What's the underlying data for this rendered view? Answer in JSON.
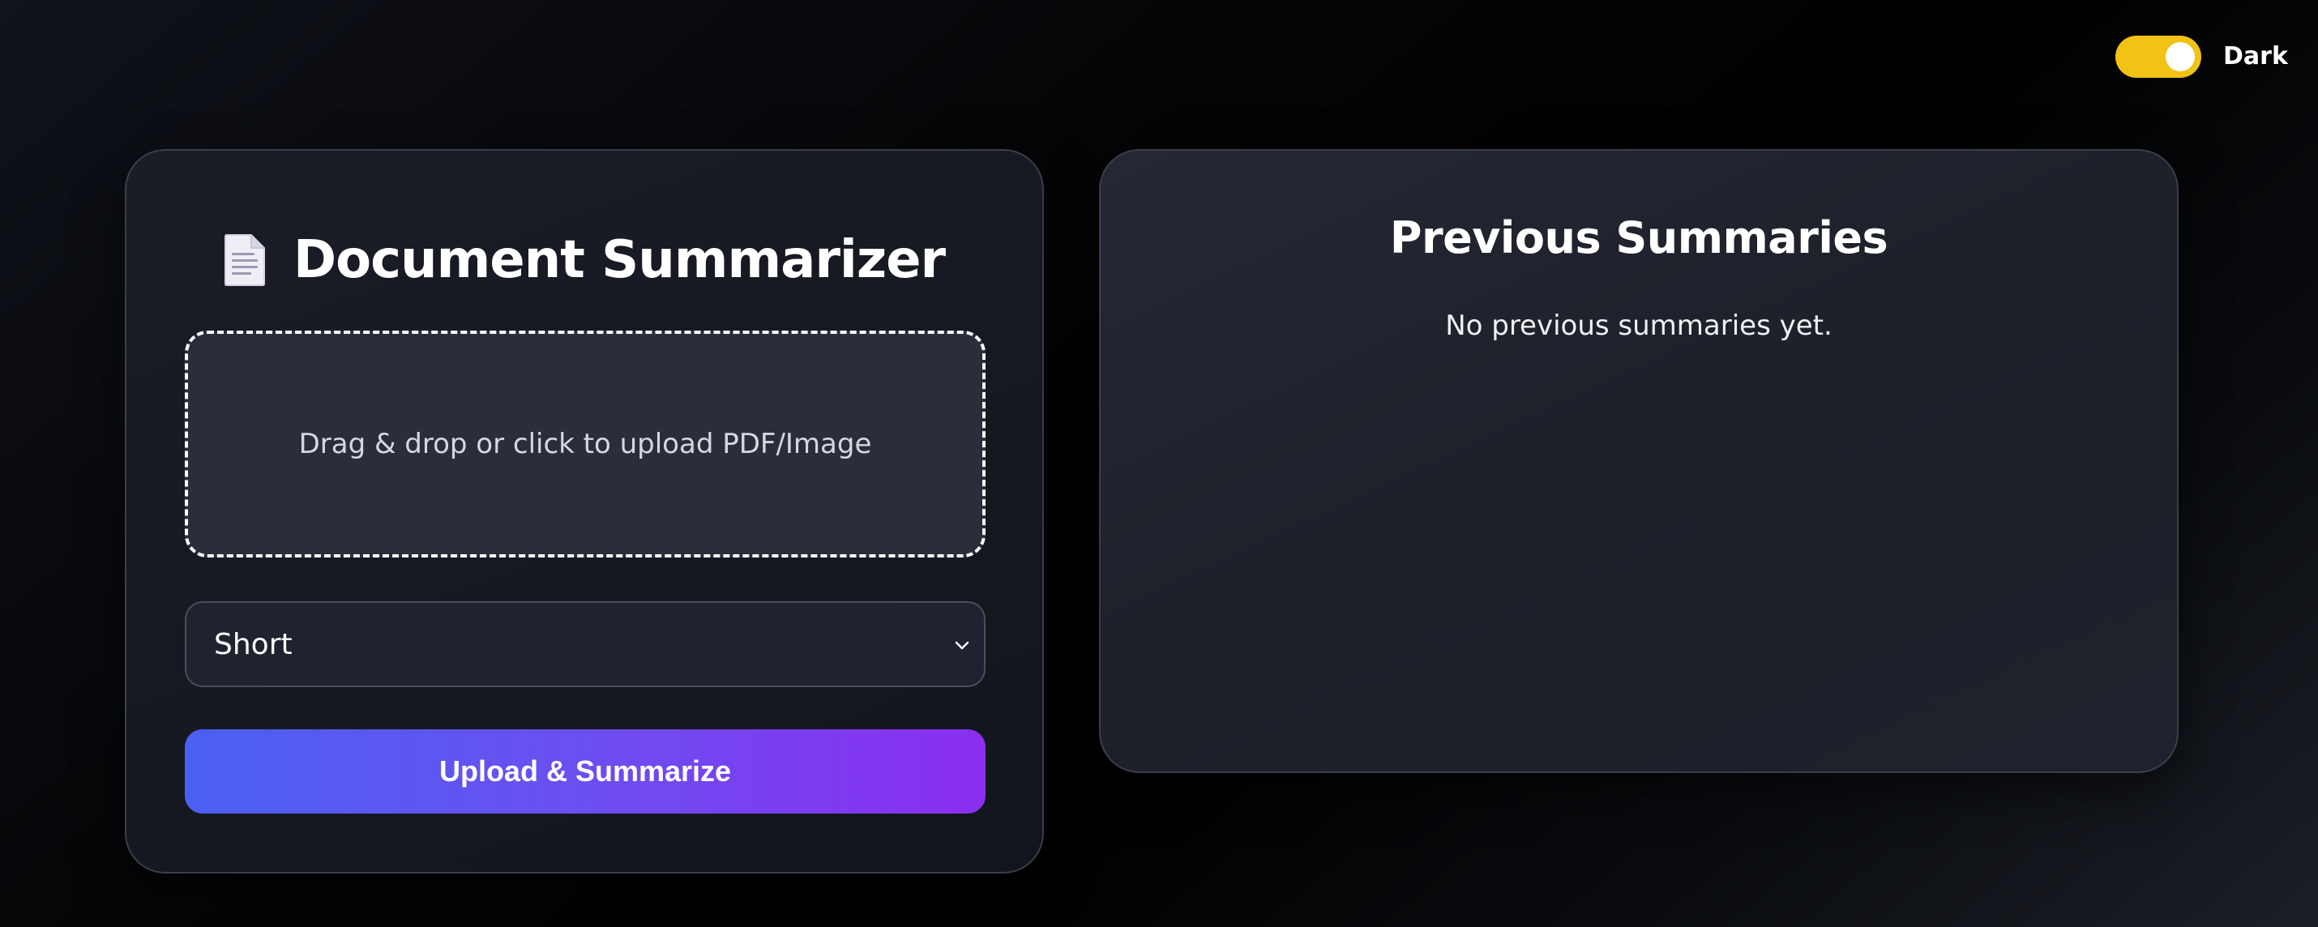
{
  "theme_toggle": {
    "label": "Dark",
    "state": "on",
    "accent_color": "#f2c214"
  },
  "summarizer_card": {
    "icon": "document-icon",
    "title": "Document Summarizer",
    "dropzone_text": "Drag & drop or click to upload PDF/Image",
    "length_select": {
      "selected": "Short"
    },
    "submit_label": "Upload & Summarize",
    "submit_gradient": [
      "#4a60f2",
      "#8b2ef0"
    ]
  },
  "history_card": {
    "title": "Previous Summaries",
    "empty_message": "No previous summaries yet."
  }
}
